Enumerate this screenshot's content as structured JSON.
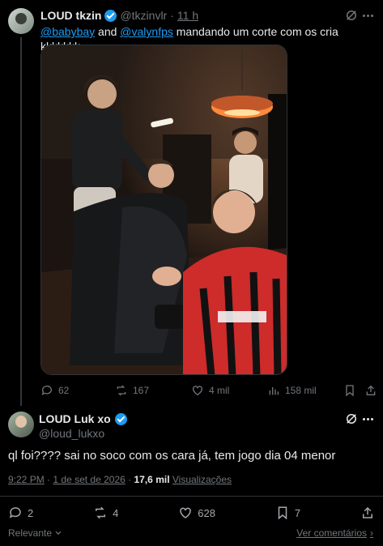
{
  "reply_tweet": {
    "display_name": "LOUD tkzin",
    "handle": "@tkzinvlr",
    "separator": "·",
    "time": "11 h",
    "text_mention_1": "@babybay",
    "text_and": " and ",
    "text_mention_2": "@valynfps",
    "text_rest": " mandando um corte com os cria kkkkkkk",
    "stats": {
      "replies": "62",
      "reposts": "167",
      "likes": "4 mil",
      "views": "158 mil"
    }
  },
  "main_tweet": {
    "display_name": "LOUD Luk xo",
    "handle": "@loud_lukxo",
    "text": "ql foi???? sai no soco com os cara já, tem jogo dia 04 menor",
    "time": "9:22 PM",
    "date": "1 de set de 2026",
    "views_count": "17,6 mil",
    "views_label": "Visualizações",
    "stats": {
      "replies": "2",
      "reposts": "4",
      "likes": "628",
      "bookmarks": "7"
    }
  },
  "footer": {
    "sort_label": "Relevante",
    "see_comments": "Ver comentários",
    "see_comments_arrow": "›"
  },
  "colors": {
    "background": "#000000",
    "text": "#e7e9ea",
    "muted": "#71767b",
    "accent": "#1d9bf0",
    "border": "#2f3336"
  }
}
